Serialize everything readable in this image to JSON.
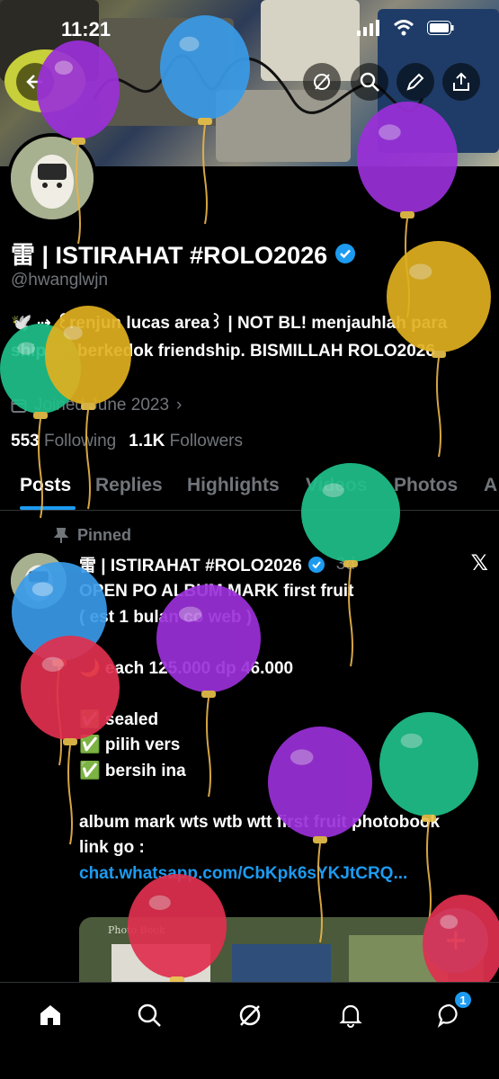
{
  "status_bar": {
    "time": "11:21"
  },
  "profile": {
    "display_name": "雷 | ISTIRAHAT #ROLO2026",
    "handle": "@hwanglwjn",
    "bio": "🕊️ ⇢ ꒰renjun lucas area꒱ | NOT BL! menjauhlah para shipper berkedok friendship. BISMILLAH ROLO2026",
    "joined": "Joined June 2023",
    "following_count": "553",
    "following_label": "Following",
    "followers_count": "1.1K",
    "followers_label": "Followers"
  },
  "tabs": [
    "Posts",
    "Replies",
    "Highlights",
    "Videos",
    "Photos",
    "A"
  ],
  "post": {
    "pinned_label": "Pinned",
    "author": "雷 | ISTIRAHAT #ROLO2026",
    "time": "3d",
    "text": "OPEN PO ALBUM MARK first fruit\n( est 1 bulan co web )\n\n🌙 each 125.000 dp 46.000\n\n✅ sealed\n✅ pilih vers\n✅ bersih ina\n\nalbum mark wts wtb wtt first fruit photobook\nlink go : ",
    "link": "chat.whatsapp.com/CbKpk6sYKJtCRQ...",
    "media_caption": "Photo Book"
  },
  "nav": {
    "messages_badge": "1"
  },
  "icons": [
    "back-arrow-icon",
    "grok-icon",
    "search-icon",
    "edit-icon",
    "share-icon",
    "verified-icon",
    "calendar-icon",
    "pin-icon",
    "x-logo-icon",
    "plus-icon",
    "home-icon",
    "notifications-icon",
    "messages-icon"
  ],
  "colors": {
    "accent": "#1d9bf0",
    "background": "#000000",
    "muted": "#71767b"
  },
  "balloons": [
    {
      "color": "#9b30d9"
    },
    {
      "color": "#3a9be8"
    },
    {
      "color": "#9b30d9"
    },
    {
      "color": "#e0b020"
    },
    {
      "color": "#1fc08a"
    },
    {
      "color": "#e0b020"
    },
    {
      "color": "#1fc08a"
    },
    {
      "color": "#3a9be8"
    },
    {
      "color": "#e0304f"
    },
    {
      "color": "#9b30d9"
    },
    {
      "color": "#9b30d9"
    },
    {
      "color": "#1fc08a"
    },
    {
      "color": "#e0304f"
    },
    {
      "color": "#e0304f"
    }
  ]
}
